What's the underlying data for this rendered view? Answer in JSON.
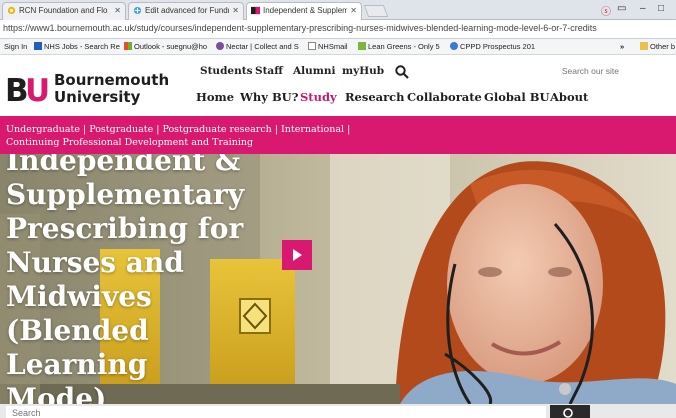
{
  "browser": {
    "tabs": [
      {
        "label": "RCN Foundation and Flo",
        "icon": "rcn-favicon"
      },
      {
        "label": "Edit advanced for Fundr",
        "icon": "edit-favicon"
      },
      {
        "label": "Independent & Suppleme",
        "icon": "bu-favicon",
        "active": true
      }
    ],
    "address": "https://www1.bournemouth.ac.uk/study/courses/independent-supplementary-prescribing-nurses-midwives-blended-learning-mode-level-6-or-7-credits",
    "bookmarks": [
      {
        "label": "Sign In"
      },
      {
        "label": "NHS Jobs - Search Re"
      },
      {
        "label": "Outlook - suegnu@ho"
      },
      {
        "label": "Nectar | Collect and S"
      },
      {
        "label": "NHSmail"
      },
      {
        "label": "Lean Greens - Only 5"
      },
      {
        "label": "CPPD Prospectus 201"
      },
      {
        "label": "»"
      },
      {
        "label": "Other b"
      }
    ]
  },
  "site": {
    "logo_mark": "BU",
    "logo_line1": "Bournemouth",
    "logo_line2": "University",
    "util_nav": [
      "Students",
      "Staff",
      "Alumni",
      "myHub"
    ],
    "search_placeholder": "Search our site",
    "main_nav": [
      "Home",
      "Why BU?",
      "Study",
      "Research",
      "Collaborate",
      "Global BU",
      "About"
    ],
    "active_nav": "Study",
    "subnav_line1": "Undergraduate | Postgraduate | Postgraduate research | International |",
    "subnav_line2": "Continuing Professional Development and Training",
    "hero_title": "Independent & Supplementary Prescribing for Nurses and Midwives (Blended Learning Mode)",
    "course_search_placeholder": "Search",
    "brand_pink": "#d9196f",
    "brand_dark": "#1e1e1e"
  }
}
